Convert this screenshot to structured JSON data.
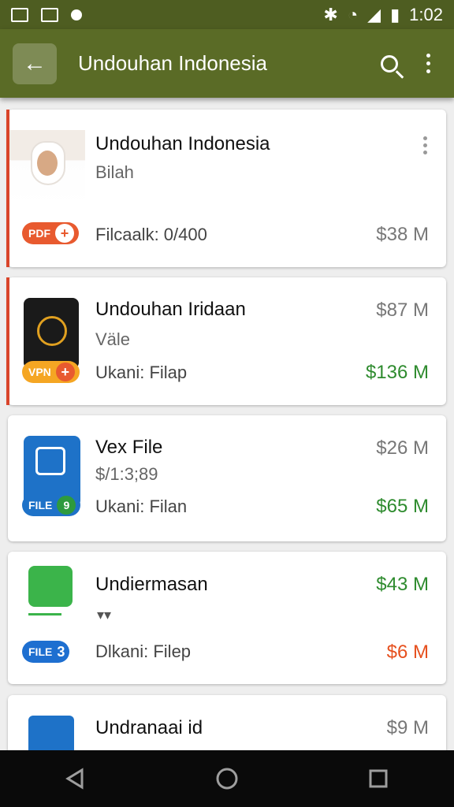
{
  "status_bar": {
    "time": "1:02",
    "icons": [
      "image-icon",
      "chart-icon",
      "record-icon",
      "bluetooth-icon",
      "wifi-icon",
      "signal-icon",
      "battery-icon"
    ]
  },
  "app_bar": {
    "title": "Undouhan Indonesia",
    "back_icon": "back-arrow-icon",
    "search_icon": "search-icon",
    "menu_icon": "more-vert-icon",
    "color": "#5a6b26"
  },
  "items": [
    {
      "title": "Undouhan Indonesia",
      "subtitle": "Bilah",
      "badge": "PDF",
      "detail": "Filcaalk: 0/400",
      "size": "$38 M",
      "size_color": "gray",
      "thumbnail": "person-photo"
    },
    {
      "title": "Undouhan Iridaan",
      "subtitle": "Väle",
      "badge": "VPN",
      "detail": "Ukani: Filap",
      "size": "$87 M",
      "size2": "$136 M",
      "thumbnail": "compass-app-icon"
    },
    {
      "title": "Vex File",
      "subtitle": "$/1:3;89",
      "badge": "FILE",
      "badge_num": "9",
      "detail": "Ukani: Filan",
      "size": "$26 M",
      "size2": "$65 M",
      "thumbnail": "file-app-icon"
    },
    {
      "title": "Undiermasan",
      "subtitle": "",
      "badge": "FILE",
      "badge_num": "3",
      "detail": "Dlkani: Filep",
      "size": "$43 M",
      "size2": "$6 M",
      "thumbnail": "folder-app-icon"
    },
    {
      "title": "Undranaai id",
      "size": "$9 M",
      "thumbnail": "document-app-icon"
    }
  ],
  "nav_bar": {
    "icons": [
      "back-triangle-icon",
      "home-circle-icon",
      "recents-square-icon"
    ]
  }
}
